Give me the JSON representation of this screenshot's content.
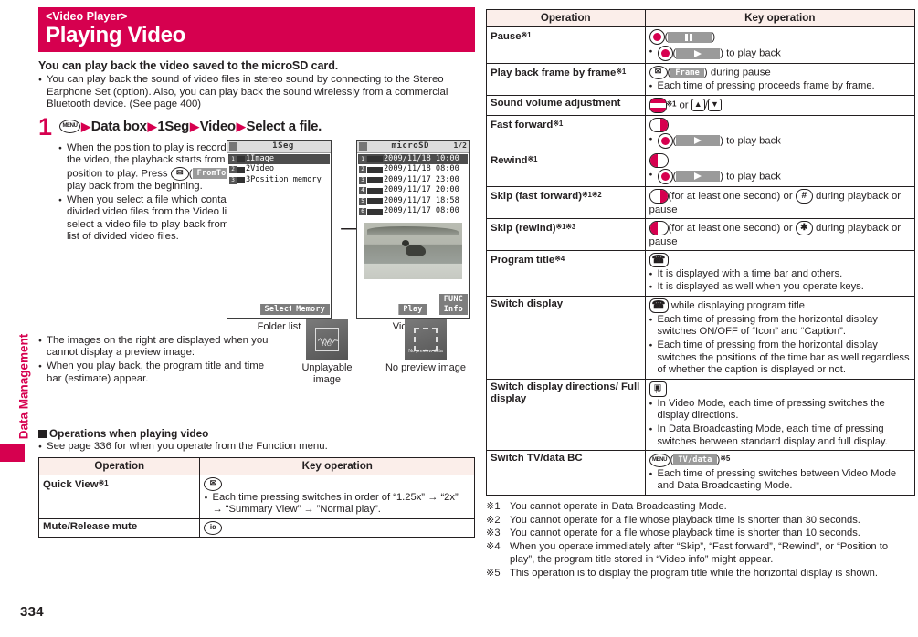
{
  "sidebar": {
    "chapter": "Data Management"
  },
  "page_number": "334",
  "header": {
    "section": "<Video Player>",
    "title": "Playing Video"
  },
  "lead": "You can play back the video saved to the microSD card.",
  "lead_bullets": [
    "You can play back the sound of video files in stereo sound by connecting to the Stereo Earphone Set (option). Also, you can play back the sound wirelessly from a commercial Bluetooth device. (See page 400)"
  ],
  "step": {
    "number": "1",
    "menu_key": "MENU",
    "path": [
      "Data box",
      "1Seg",
      "Video",
      "Select a file."
    ],
    "bullets": [
      "When the position to play is recorded to the video, the playback starts from the position to play. Press",
      "When you select a file which contains divided video files from the Video list, select a video file to play back from the list of divided video files."
    ],
    "bullet1_tail": "to play back from the beginning.",
    "fromtop_chip": "FromTop"
  },
  "screens": {
    "folder": {
      "title": "1Seg",
      "caption": "Folder list",
      "rows": [
        "1Image",
        "2Video",
        "3Position memory"
      ],
      "softkey_center": "Select",
      "softkey_right": "Memory"
    },
    "video": {
      "title": "microSD",
      "page": "1/2",
      "caption": "Video list",
      "rows": [
        "2009/11/18 10:00",
        "2009/11/18 08:00",
        "2009/11/17 23:00",
        "2009/11/17 20:00",
        "2009/11/17 18:58",
        "2009/11/17 08:00"
      ],
      "softkey_center": "Play",
      "softkey_right_top": "FUNC",
      "softkey_right_bottom": "Info"
    }
  },
  "thumbs": {
    "unplayable_caption": "Unplayable image",
    "unplayable_label": "NG",
    "nopreview_caption": "No preview image",
    "nopreview_label": "No preview data"
  },
  "post_bullets": [
    "The images on the right are displayed when you cannot display a preview image:",
    "When you play back, the program title and time bar (estimate) appear."
  ],
  "section_heading": "Operations when playing video",
  "section_bullet": "See page 336 for when you operate from the Function menu.",
  "table": {
    "head_operation": "Operation",
    "head_key": "Key operation"
  },
  "left_table_rows": [
    {
      "op": "Quick View",
      "mark": "※1",
      "bullets": [
        "Each time pressing switches in order of “1.25x” → “2x” → “Summary View” → ”Normal play”."
      ]
    },
    {
      "op": "Mute/Release mute",
      "mark": "",
      "bullets": []
    }
  ],
  "right_table_rows": [
    {
      "op": "Pause",
      "mark": "※1",
      "line1_suffix": "",
      "bullets": [
        "to play back"
      ]
    },
    {
      "op": "Play back frame by frame",
      "mark": "※1",
      "chip": "Frame",
      "line1_suffix": "during pause",
      "bullets": [
        "Each time of pressing proceeds frame by frame."
      ]
    },
    {
      "op": "Sound volume adjustment",
      "mark": "※1",
      "or_text": "or",
      "bullets": []
    },
    {
      "op": "Fast forward",
      "mark": "※1",
      "bullets": [
        "to play back"
      ]
    },
    {
      "op": "Rewind",
      "mark": "※1",
      "bullets": [
        "to play back"
      ]
    },
    {
      "op": "Skip (fast forward)",
      "mark": "※1※2",
      "text": "(for at least one second) or",
      "text2": "during playback or pause",
      "bullets": []
    },
    {
      "op": "Skip (rewind)",
      "mark": "※1※3",
      "text": "(for at least one second) or",
      "text2": "during playback or pause",
      "bullets": []
    },
    {
      "op": "Program title",
      "mark": "※4",
      "bullets": [
        "It is displayed with a time bar and others.",
        "It is displayed as well when you operate keys."
      ]
    },
    {
      "op": "Switch display",
      "mark": "",
      "text": "while displaying program title",
      "bullets": [
        "Each time of pressing from the horizontal display switches ON/OFF of “Icon” and “Caption”.",
        "Each time of pressing from the horizontal display switches the positions of the time bar as well regardless of whether the caption is displayed or not."
      ]
    },
    {
      "op": "Switch display directions/ Full display",
      "mark": "",
      "bullets": [
        "In Video Mode, each time of pressing switches the display directions.",
        "In Data Broadcasting Mode, each time of pressing switches between standard display and full display."
      ]
    },
    {
      "op": "Switch TV/data BC",
      "mark": "",
      "chip": "TV/data",
      "chip_mark": "※5",
      "bullets": [
        "Each time of pressing switches between Video Mode and Data Broadcasting Mode."
      ]
    }
  ],
  "footnotes": [
    {
      "label": "※1",
      "text": "You cannot operate in Data Broadcasting Mode."
    },
    {
      "label": "※2",
      "text": "You cannot operate for a file whose playback time is shorter than 30 seconds."
    },
    {
      "label": "※3",
      "text": "You cannot operate for a file whose playback time is shorter than 10 seconds."
    },
    {
      "label": "※4",
      "text": "When you operate immediately after “Skip”, “Fast forward”, “Rewind”, or “Position to play”, the program title stored in “Video info” might appear."
    },
    {
      "label": "※5",
      "text": "This operation is to display the program title while the horizontal display is shown."
    }
  ],
  "colors": {
    "brand": "#d6004f",
    "table_head": "#fbeeea",
    "ink": "#231f20"
  }
}
